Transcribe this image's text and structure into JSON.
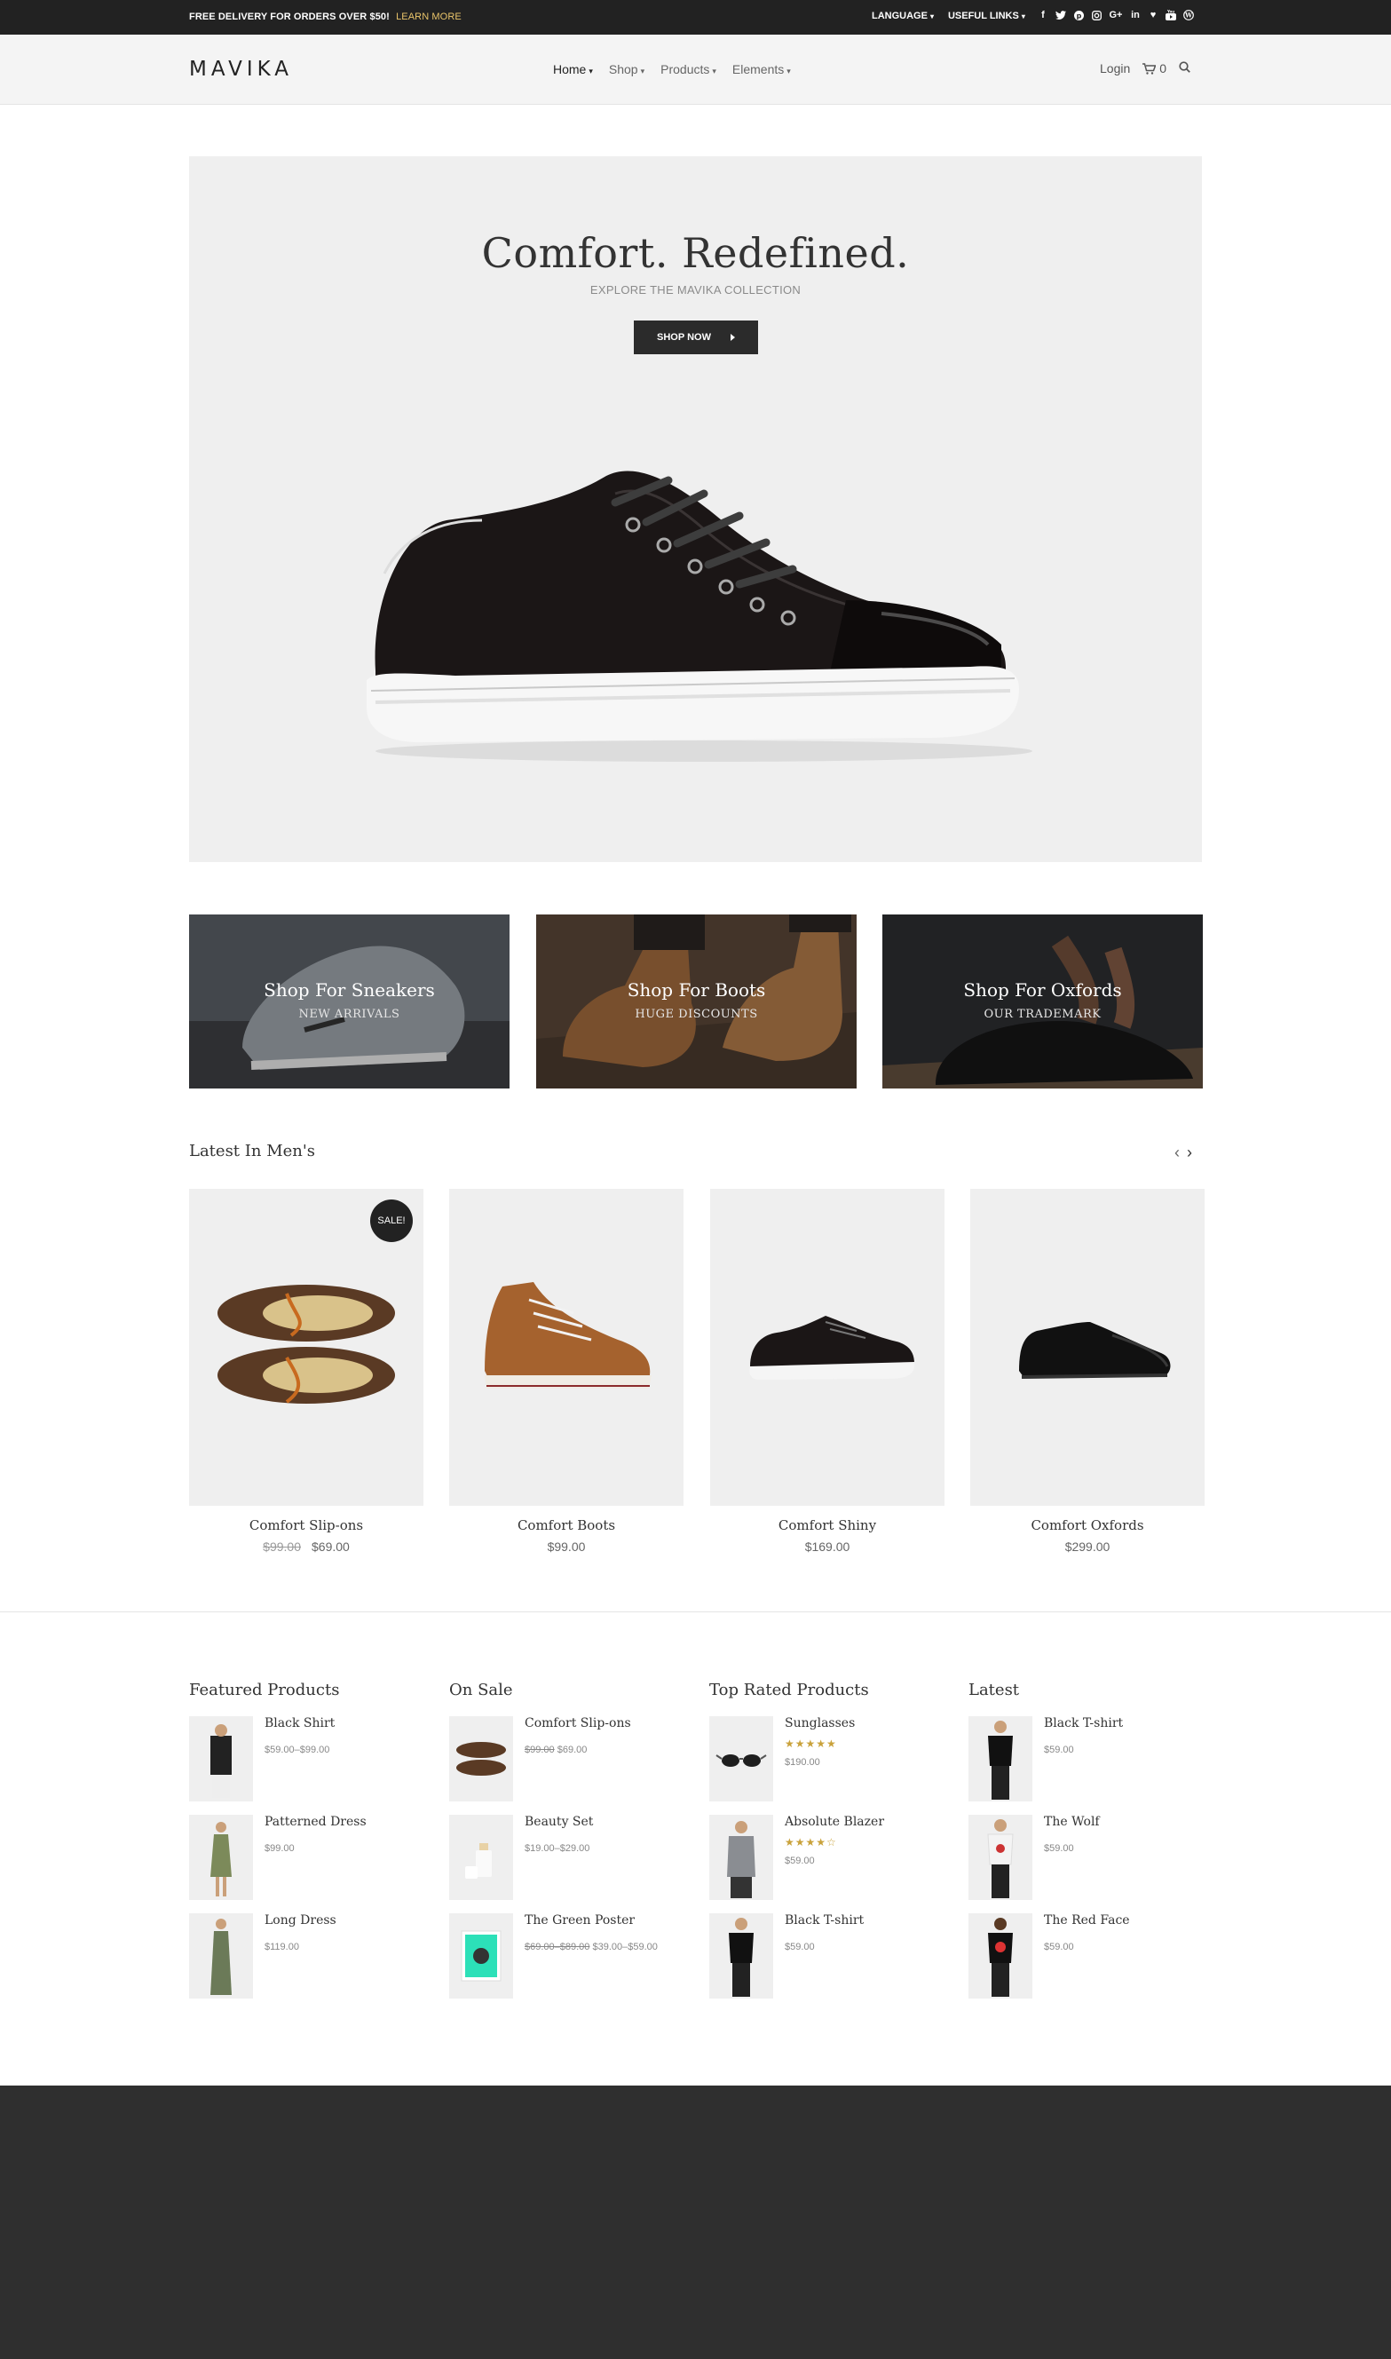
{
  "topbar": {
    "promo": "FREE DELIVERY FOR ORDERS OVER $50!",
    "learn_more": "LEARN MORE",
    "language": "LANGUAGE",
    "useful_links": "USEFUL LINKS",
    "social": [
      "facebook-icon",
      "twitter-icon",
      "pinterest-icon",
      "instagram-icon",
      "google-plus-icon",
      "linkedin-icon",
      "heart-icon",
      "youtube-icon",
      "wordpress-icon"
    ]
  },
  "header": {
    "logo": "MAVIKA",
    "nav": [
      "Home",
      "Shop",
      "Products",
      "Elements"
    ],
    "login": "Login",
    "cart_count": "0"
  },
  "hero": {
    "title": "Comfort. Redefined.",
    "subtitle": "EXPLORE THE MAVIKA COLLECTION",
    "button": "SHOP NOW"
  },
  "categories": [
    {
      "title": "Shop For Sneakers",
      "subtitle": "NEW ARRIVALS"
    },
    {
      "title": "Shop For Boots",
      "subtitle": "HUGE DISCOUNTS"
    },
    {
      "title": "Shop For Oxfords",
      "subtitle": "OUR TRADEMARK"
    }
  ],
  "latest": {
    "title": "Latest In Men's",
    "products": [
      {
        "name": "Comfort Slip-ons",
        "old_price": "$99.00",
        "price": "$69.00",
        "badge": "SALE!"
      },
      {
        "name": "Comfort Boots",
        "price": "$99.00"
      },
      {
        "name": "Comfort Shiny",
        "price": "$169.00"
      },
      {
        "name": "Comfort Oxfords",
        "price": "$299.00"
      }
    ]
  },
  "widgets": {
    "featured": {
      "title": "Featured Products",
      "items": [
        {
          "name": "Black Shirt",
          "price": "$59.00–$99.00"
        },
        {
          "name": "Patterned Dress",
          "price": "$99.00"
        },
        {
          "name": "Long Dress",
          "price": "$119.00"
        }
      ]
    },
    "on_sale": {
      "title": "On Sale",
      "items": [
        {
          "name": "Comfort Slip-ons",
          "old_price": "$99.00",
          "price": "$69.00"
        },
        {
          "name": "Beauty Set",
          "price": "$19.00–$29.00"
        },
        {
          "name": "The Green Poster",
          "old_price": "$69.00–$89.00",
          "price": "$39.00–$59.00"
        }
      ]
    },
    "top_rated": {
      "title": "Top Rated Products",
      "items": [
        {
          "name": "Sunglasses",
          "rating": 5,
          "stars": "★★★★★",
          "price": "$190.00"
        },
        {
          "name": "Absolute Blazer",
          "rating": 4,
          "stars": "★★★★☆",
          "price": "$59.00"
        },
        {
          "name": "Black T-shirt",
          "price": "$59.00"
        }
      ]
    },
    "latest": {
      "title": "Latest",
      "items": [
        {
          "name": "Black T-shirt",
          "price": "$59.00"
        },
        {
          "name": "The Wolf",
          "price": "$59.00"
        },
        {
          "name": "The Red Face",
          "price": "$59.00"
        }
      ]
    }
  },
  "colors": {
    "dark": "#222222",
    "accent": "#e9c46a",
    "hero_bg": "#efefef",
    "footer_bg": "#2f2f2f",
    "star": "#c9a23b"
  }
}
